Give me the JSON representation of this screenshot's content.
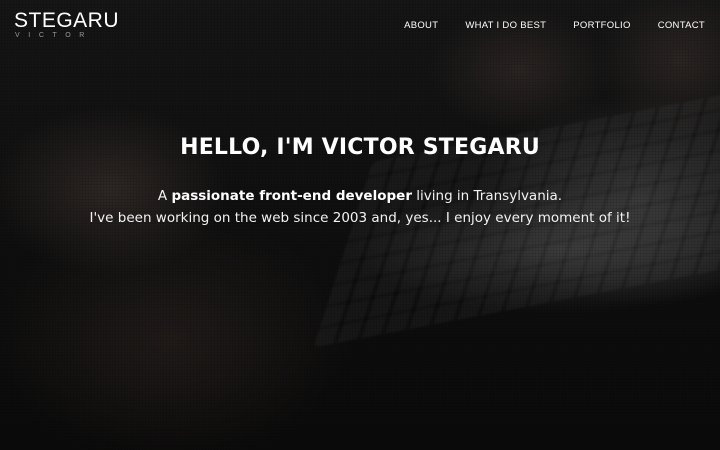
{
  "logo": {
    "name": "STEGARU",
    "subname": "VICTOR"
  },
  "nav": {
    "items": [
      {
        "label": "ABOUT"
      },
      {
        "label": "WHAT I DO BEST"
      },
      {
        "label": "PORTFOLIO"
      },
      {
        "label": "CONTACT"
      }
    ]
  },
  "hero": {
    "headline": "HELLO, I'M VICTOR STEGARU",
    "intro": {
      "line1_prefix": "A ",
      "line1_strong": "passionate front-end developer",
      "line1_suffix": " living in Transylvania.",
      "line2": "I've been working on the web since 2003 and, yes... I enjoy every moment of it!"
    }
  },
  "colors": {
    "text": "#ffffff",
    "overlay": "#000000"
  }
}
